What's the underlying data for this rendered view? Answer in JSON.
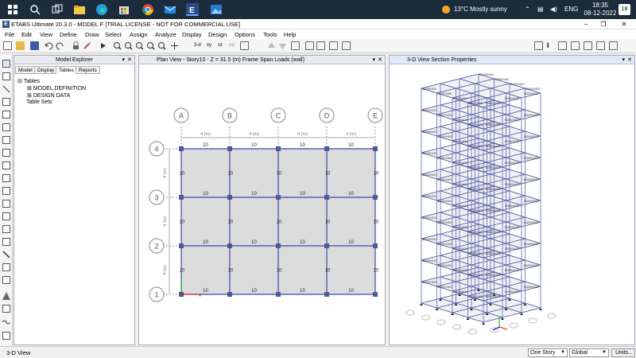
{
  "taskbar": {
    "weather": "13°C  Mostly sunny",
    "language": "ENG",
    "time": "18:35",
    "date": "08-12-2022",
    "notification_count": "18"
  },
  "window": {
    "title": "ETABS Ultimate 20.3.0 - MODEL F  [TRIAL LICENSE - NOT FOR COMMERCIAL USE]"
  },
  "menu": [
    "File",
    "Edit",
    "View",
    "Define",
    "Draw",
    "Select",
    "Assign",
    "Analyze",
    "Display",
    "Design",
    "Options",
    "Tools",
    "Help"
  ],
  "model_explorer": {
    "title": "Model Explorer",
    "tabs": [
      "Model",
      "Display",
      "Tables",
      "Reports"
    ],
    "active_tab": "Tables",
    "tree": {
      "root": "Tables",
      "children": [
        "MODEL DEFINITION",
        "DESIGN DATA"
      ],
      "sibling": "Table Sets"
    }
  },
  "plan_view": {
    "title": "Plan View - Story10 - Z = 31.5 (m)  Frame Span Loads (wall)",
    "grid_columns": [
      "A",
      "B",
      "C",
      "D",
      "E"
    ],
    "grid_rows": [
      "4",
      "3",
      "2",
      "1"
    ],
    "bay_dimension": "4 (m)",
    "load_value": "10"
  },
  "view_3d": {
    "title": "3-D View  Section Properties",
    "section_label": "B300X400"
  },
  "status_bar": {
    "left": "3-D View",
    "story_select": "One Story",
    "coord_select": "Global",
    "units_button": "Units..."
  },
  "colors": {
    "grid_line": "#3b4aa0",
    "joint": "#4a5a9a",
    "slab": "#dcdcdc",
    "taskbar": "#1c2c3c"
  }
}
